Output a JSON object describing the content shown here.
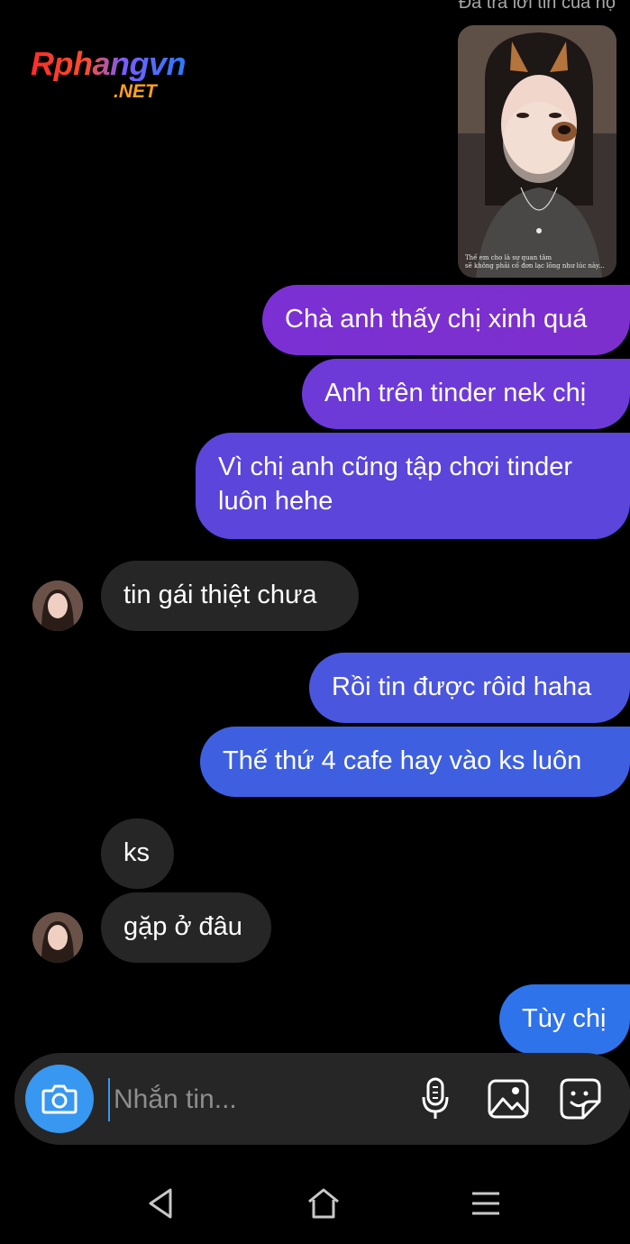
{
  "header": {
    "replied_label": "Đã trả lời tin của họ"
  },
  "watermark": {
    "name": "Rphangvn",
    "suffix": ".NET"
  },
  "story": {
    "caption_line1": "Thế em cho là sự quan tâm",
    "caption_line2": "sẽ không phải cố đơn lạc lõng như lúc này..."
  },
  "messages": [
    {
      "from": "me",
      "text": "Chà anh thấy chị xinh quá"
    },
    {
      "from": "me",
      "text": "Anh trên tinder nek chị"
    },
    {
      "from": "me",
      "text_line1": "Vì chị anh cũng tập chơi tinder",
      "text_line2": "luôn hehe"
    },
    {
      "from": "them",
      "text": "tin gái thiệt chưa"
    },
    {
      "from": "me",
      "text": "Rồi tin được rôid haha"
    },
    {
      "from": "me",
      "text": "Thế thứ 4 cafe hay vào ks luôn"
    },
    {
      "from": "them",
      "text": "ks"
    },
    {
      "from": "them",
      "text": "gặp ở đâu"
    },
    {
      "from": "me",
      "text": "Tùy chị"
    }
  ],
  "composer": {
    "placeholder": "Nhắn tin...",
    "camera_icon": "camera-icon",
    "mic_icon": "microphone-icon",
    "gallery_icon": "image-icon",
    "sticker_icon": "sticker-icon"
  },
  "navbar": {
    "back_icon": "back-triangle-icon",
    "home_icon": "home-icon",
    "menu_icon": "menu-lines-icon"
  },
  "colors": {
    "background": "#000000",
    "bubble_incoming": "#262626",
    "bubble_purple": "#7b2fd0",
    "bubble_violet": "#5a43d8",
    "bubble_blue": "#3f5ee0",
    "accent_blue": "#3897f0",
    "composer_bg": "#262626"
  }
}
